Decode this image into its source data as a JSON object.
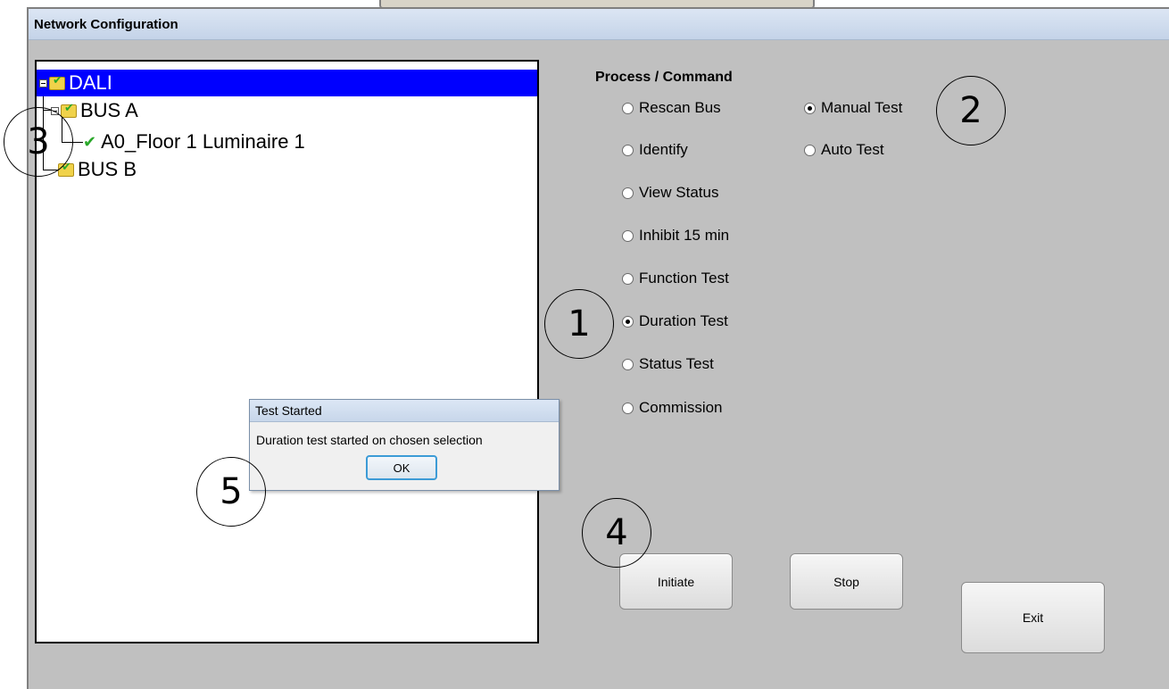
{
  "window": {
    "title": "Network Configuration"
  },
  "tree": {
    "root": {
      "label": "DALI",
      "selected": true
    },
    "items": [
      {
        "label": "BUS A",
        "icon": "folder-check-icon"
      },
      {
        "label": "A0_Floor 1 Luminaire 1",
        "icon": "check-icon"
      },
      {
        "label": "BUS B",
        "icon": "folder-check-icon"
      }
    ]
  },
  "commands": {
    "title": "Process / Command",
    "options": [
      {
        "label": "Rescan Bus",
        "checked": false
      },
      {
        "label": "Identify",
        "checked": false
      },
      {
        "label": "View Status",
        "checked": false
      },
      {
        "label": "Inhibit 15 min",
        "checked": false
      },
      {
        "label": "Function Test",
        "checked": false
      },
      {
        "label": "Duration Test",
        "checked": true
      },
      {
        "label": "Status Test",
        "checked": false
      },
      {
        "label": "Commission",
        "checked": false
      }
    ],
    "modes": [
      {
        "label": "Manual Test",
        "checked": true
      },
      {
        "label": "Auto Test",
        "checked": false
      }
    ]
  },
  "buttons": {
    "initiate": "Initiate",
    "stop": "Stop",
    "exit": "Exit"
  },
  "dialog": {
    "title": "Test Started",
    "message": "Duration test started on chosen selection",
    "ok": "OK"
  },
  "callouts": [
    "1",
    "2",
    "3",
    "4",
    "5"
  ],
  "colors": {
    "selection": "#0000ff",
    "panel": "#c0c0c0",
    "check": "#2aa82a"
  }
}
